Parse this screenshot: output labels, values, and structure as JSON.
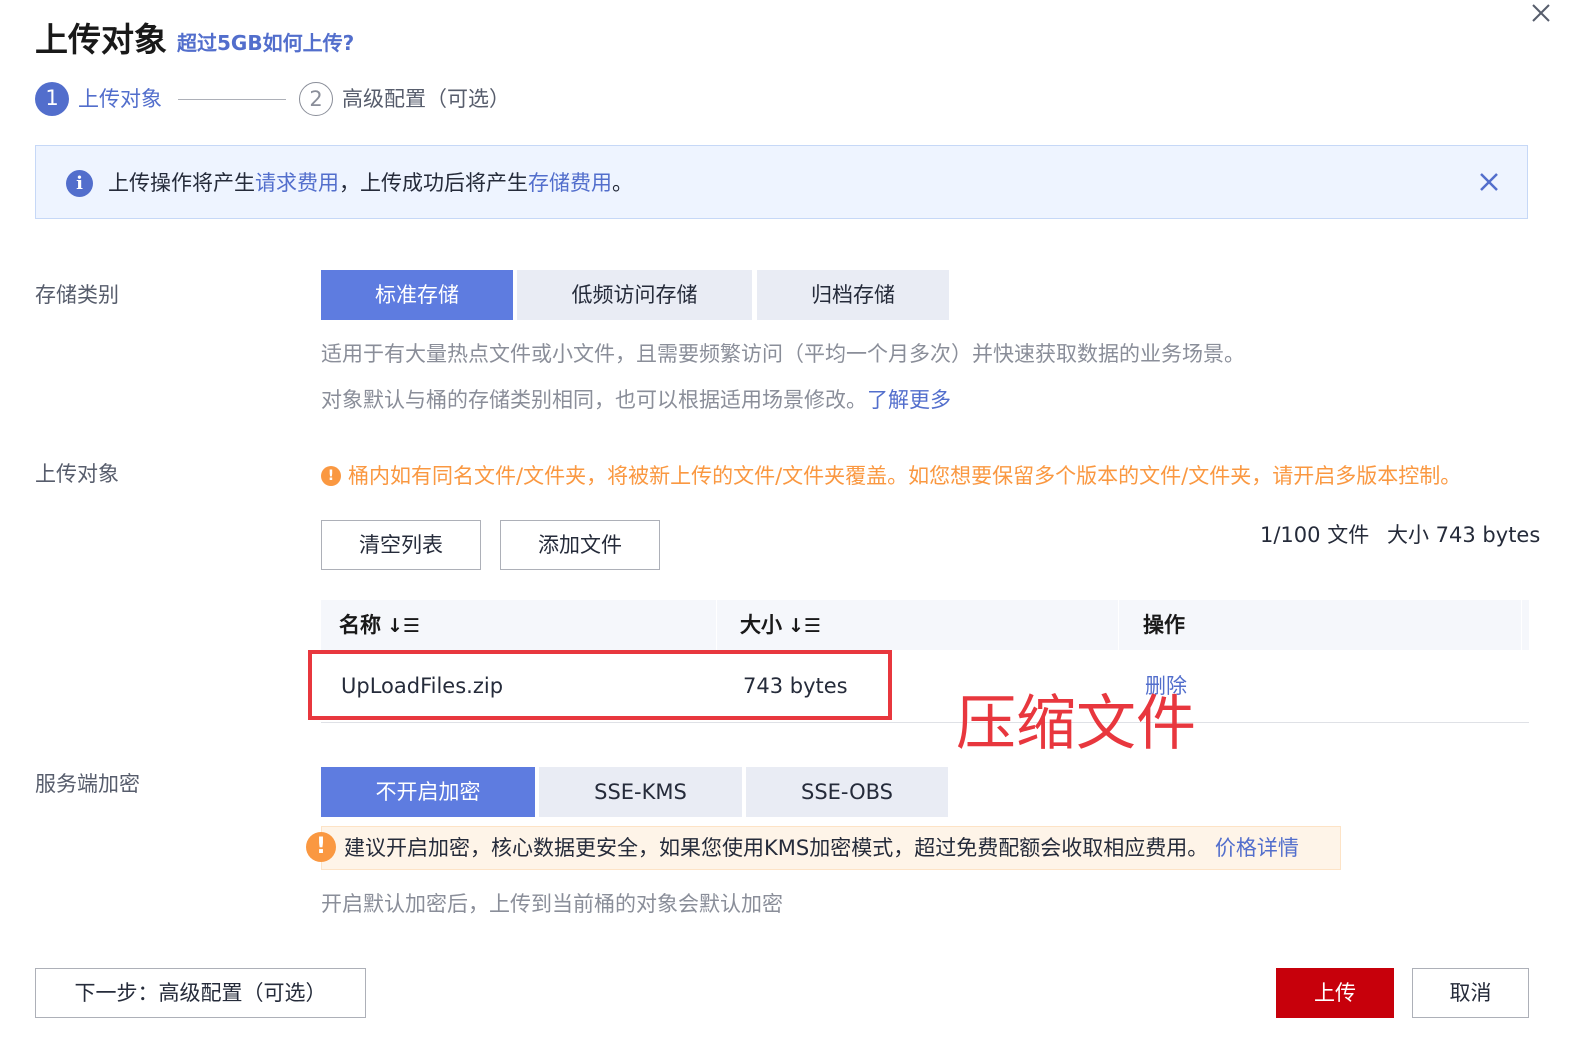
{
  "header": {
    "title": "上传对象",
    "help_link": "超过5GB如何上传?"
  },
  "steps": [
    {
      "number": "1",
      "label": "上传对象"
    },
    {
      "number": "2",
      "label": "高级配置（可选）"
    }
  ],
  "banner": {
    "text_before": "上传操作将产生",
    "link1": "请求费用",
    "text_middle": "，上传成功后将产生",
    "link2": "存储费用",
    "text_after": "。"
  },
  "storage_class": {
    "label": "存储类别",
    "options": [
      "标准存储",
      "低频访问存储",
      "归档存储"
    ],
    "selected": "标准存储",
    "hint1": "适用于有大量热点文件或小文件，且需要频繁访问（平均一个月多次）并快速获取数据的业务场景。",
    "hint2": "对象默认与桶的存储类别相同，也可以根据适用场景修改。",
    "learn_more": "了解更多"
  },
  "upload_objects": {
    "label": "上传对象",
    "warning": "桶内如有同名文件/文件夹，将被新上传的文件/文件夹覆盖。如您想要保留多个版本的文件/文件夹，请开启多版本控制。",
    "clear_button": "清空列表",
    "add_button": "添加文件",
    "count": "1/100 文件",
    "size_total": "大小 743 bytes",
    "columns": [
      "名称",
      "大小",
      "操作"
    ],
    "rows": [
      {
        "name": "UpLoadFiles.zip",
        "size": "743 bytes",
        "action": "删除"
      }
    ],
    "annotation": "压缩文件"
  },
  "encryption": {
    "label": "服务端加密",
    "options": [
      "不开启加密",
      "SSE-KMS",
      "SSE-OBS"
    ],
    "selected": "不开启加密",
    "warning": "建议开启加密，核心数据更安全，如果您使用KMS加密模式，超过免费配额会收取相应费用。",
    "price_link": "价格详情",
    "hint": "开启默认加密后，上传到当前桶的对象会默认加密"
  },
  "footer": {
    "next_button": "下一步：高级配置（可选）",
    "upload_button": "上传",
    "cancel_button": "取消"
  },
  "colors": {
    "primary": "#526ecc",
    "segment_active": "#5e7ce0",
    "upload_red": "#c7000b",
    "warning_orange": "#fa9841",
    "annotation_red": "#e8373e"
  }
}
